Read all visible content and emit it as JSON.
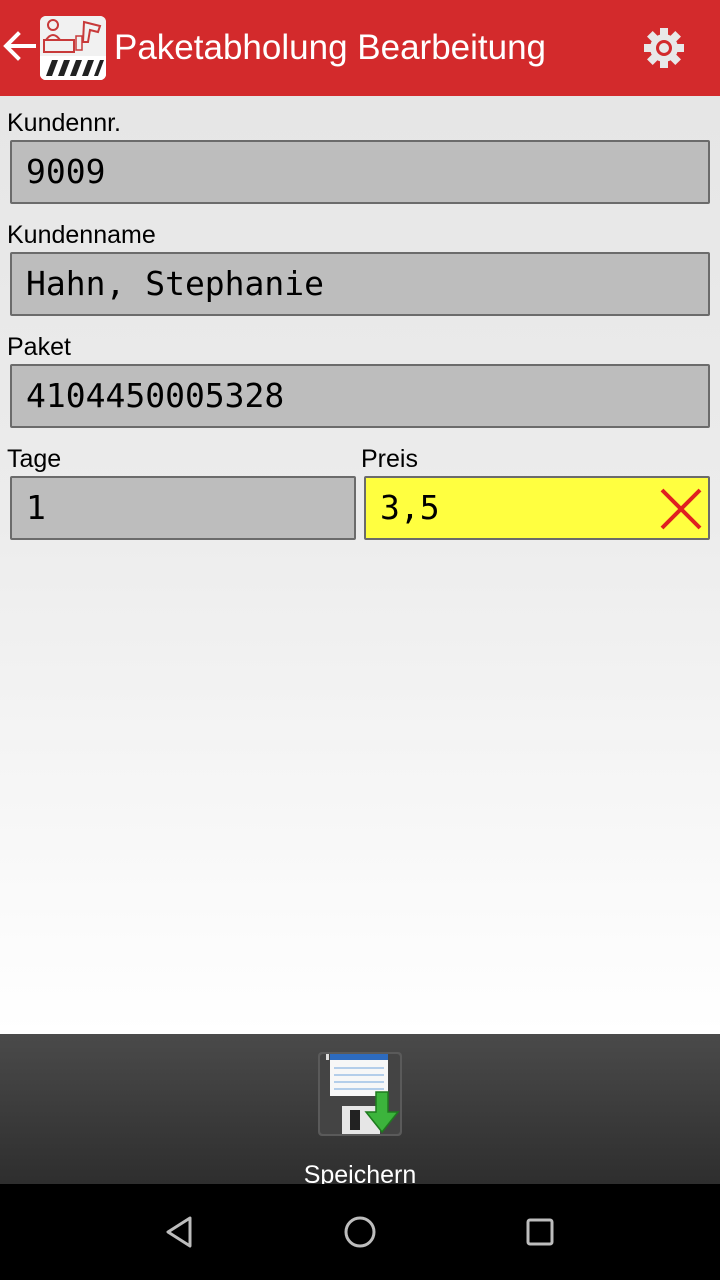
{
  "appbar": {
    "title": "Paketabholung Bearbeitung",
    "color": "#d32a2c",
    "icons": [
      "back-arrow-icon",
      "app-logo",
      "gear-icon"
    ]
  },
  "form": {
    "customer_number": {
      "label": "Kundennr.",
      "value": "9009"
    },
    "customer_name": {
      "label": "Kundenname",
      "value": "Hahn, Stephanie"
    },
    "package": {
      "label": "Paket",
      "value": "4104450005328"
    },
    "days": {
      "label": "Tage",
      "value": "1"
    },
    "price": {
      "label": "Preis",
      "value": "3,5",
      "highlight_color": "#ffff40"
    }
  },
  "bottombar": {
    "save_label": "Speichern",
    "save_icon": "floppy-disk-download-icon"
  },
  "navbar": {
    "icons": [
      "nav-back-icon",
      "nav-home-icon",
      "nav-recents-icon"
    ]
  }
}
